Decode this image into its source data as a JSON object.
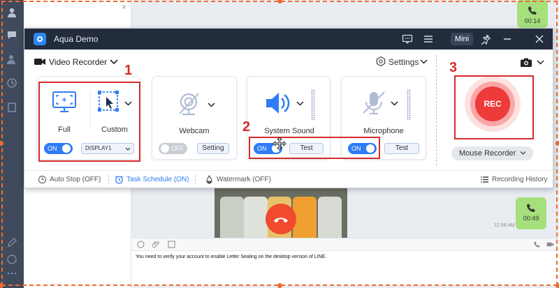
{
  "background_chat": {
    "bubbles": [
      {
        "duration": "00:14"
      },
      {
        "duration": "00:49"
      }
    ],
    "timestamp": "12:58 AM",
    "notice": "You need to verify your account to enable Letter Sealing on the desktop version of LINE."
  },
  "recorder": {
    "title": "Aqua Demo",
    "mini_label": "Mini",
    "mode_label": "Video Recorder",
    "settings_label": "Settings",
    "full_label": "Full",
    "custom_label": "Custom",
    "screen_toggle": "ON",
    "display_select": "DISPLAY1",
    "webcam_label": "Webcam",
    "webcam_toggle": "OFF",
    "webcam_setting_label": "Setting",
    "system_sound_label": "System Sound",
    "system_sound_toggle": "ON",
    "system_sound_test_label": "Test",
    "microphone_label": "Microphone",
    "microphone_toggle": "ON",
    "microphone_test_label": "Test",
    "rec_label": "REC",
    "mouse_recorder_label": "Mouse Recorder",
    "footer": {
      "auto_stop": "Auto Stop (OFF)",
      "task_schedule": "Task Schedule (ON)",
      "watermark": "Watermark (OFF)",
      "recording_history": "Recording History"
    }
  },
  "annotations": [
    "1",
    "2",
    "3"
  ],
  "colors": {
    "titlebar": "#232c3d",
    "accent_blue": "#2f7cf6",
    "rec_red": "#ee3a3a",
    "annotation_red": "#d62b2b",
    "capture_border": "#f26a2a"
  }
}
